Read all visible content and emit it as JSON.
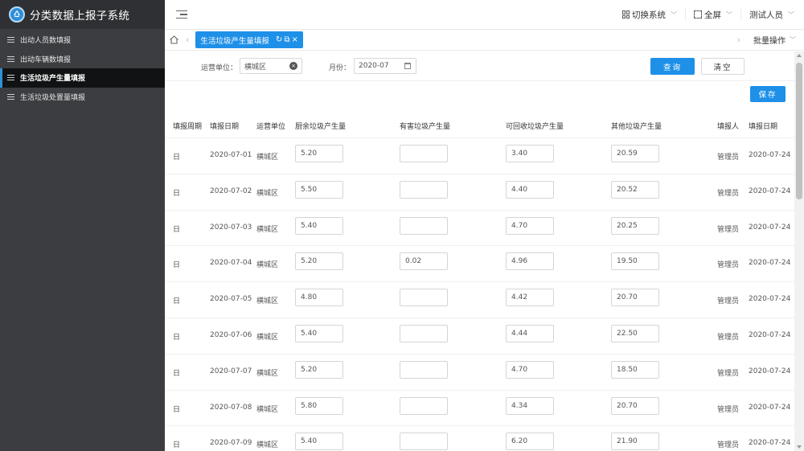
{
  "app": {
    "title": "分类数据上报子系统"
  },
  "sidebar": {
    "items": [
      {
        "label": "出动人员数填报",
        "active": false
      },
      {
        "label": "出动车辆数填报",
        "active": false
      },
      {
        "label": "生活垃圾产生量填报",
        "active": true
      },
      {
        "label": "生活垃圾处置量填报",
        "active": false
      }
    ]
  },
  "topbar": {
    "switch_system": "切换系统",
    "fullscreen": "全屏",
    "user": "测试人员"
  },
  "tabs": {
    "active_tab": "生活垃圾产生量填报",
    "batch_ops": "批量操作"
  },
  "filter": {
    "unit_label": "运营单位：",
    "unit_value": "横城区",
    "month_label": "月份：",
    "month_value": "2020-07",
    "query_btn": "查询",
    "clear_btn": "清空"
  },
  "save_btn": "保存",
  "table": {
    "headers": [
      "填报周期",
      "填报日期",
      "运营单位",
      "厨余垃圾产生量",
      "有害垃圾产生量",
      "可回收垃圾产生量",
      "其他垃圾产生量",
      "填报人",
      "填报日期"
    ],
    "rows": [
      {
        "period": "日",
        "date": "2020-07-01",
        "unit": "横城区",
        "kitchen": "5.20",
        "hazardous": "",
        "recyclable": "3.40",
        "other": "20.59",
        "reporter": "管理员",
        "report_date": "2020-07-24"
      },
      {
        "period": "日",
        "date": "2020-07-02",
        "unit": "横城区",
        "kitchen": "5.50",
        "hazardous": "",
        "recyclable": "4.40",
        "other": "20.52",
        "reporter": "管理员",
        "report_date": "2020-07-24"
      },
      {
        "period": "日",
        "date": "2020-07-03",
        "unit": "横城区",
        "kitchen": "5.40",
        "hazardous": "",
        "recyclable": "4.70",
        "other": "20.25",
        "reporter": "管理员",
        "report_date": "2020-07-24"
      },
      {
        "period": "日",
        "date": "2020-07-04",
        "unit": "横城区",
        "kitchen": "5.20",
        "hazardous": "0.02",
        "recyclable": "4.96",
        "other": "19.50",
        "reporter": "管理员",
        "report_date": "2020-07-24"
      },
      {
        "period": "日",
        "date": "2020-07-05",
        "unit": "横城区",
        "kitchen": "4.80",
        "hazardous": "",
        "recyclable": "4.42",
        "other": "20.70",
        "reporter": "管理员",
        "report_date": "2020-07-24"
      },
      {
        "period": "日",
        "date": "2020-07-06",
        "unit": "横城区",
        "kitchen": "5.40",
        "hazardous": "",
        "recyclable": "4.44",
        "other": "22.50",
        "reporter": "管理员",
        "report_date": "2020-07-24"
      },
      {
        "period": "日",
        "date": "2020-07-07",
        "unit": "横城区",
        "kitchen": "5.20",
        "hazardous": "",
        "recyclable": "4.70",
        "other": "18.50",
        "reporter": "管理员",
        "report_date": "2020-07-24"
      },
      {
        "period": "日",
        "date": "2020-07-08",
        "unit": "横城区",
        "kitchen": "5.80",
        "hazardous": "",
        "recyclable": "4.34",
        "other": "20.70",
        "reporter": "管理员",
        "report_date": "2020-07-24"
      },
      {
        "period": "日",
        "date": "2020-07-09",
        "unit": "横城区",
        "kitchen": "5.40",
        "hazardous": "",
        "recyclable": "6.20",
        "other": "21.90",
        "reporter": "管理员",
        "report_date": "2020-07-24"
      }
    ]
  },
  "colors": {
    "primary": "#1e90e8",
    "sidebar_bg": "#3b3d40",
    "sidebar_active": "#111213"
  }
}
